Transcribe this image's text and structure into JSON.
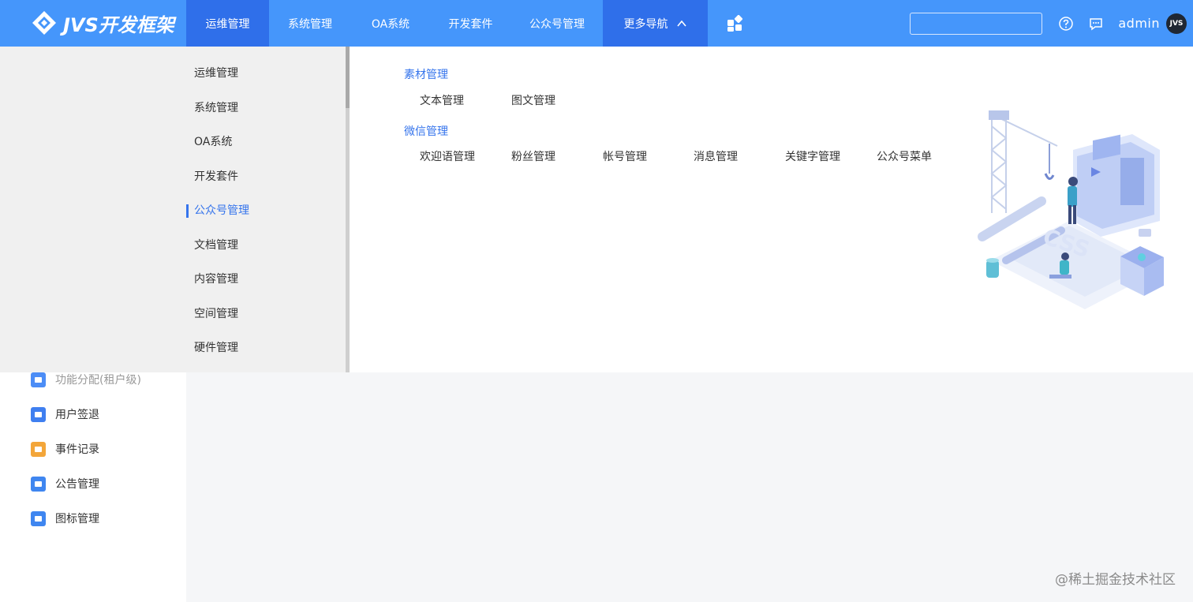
{
  "app": {
    "logo_text": "JVS开发框架"
  },
  "topnav": {
    "items": [
      {
        "label": "运维管理"
      },
      {
        "label": "系统管理"
      },
      {
        "label": "OA系统"
      },
      {
        "label": "开发套件"
      },
      {
        "label": "公众号管理"
      },
      {
        "label": "更多导航"
      }
    ]
  },
  "header": {
    "search_value": "",
    "user": "admin",
    "avatar_text": "JVS"
  },
  "sidebar": {
    "items": [
      {
        "label": "功能分配(租户级)",
        "color": "#4c8df6"
      },
      {
        "label": "用户签退",
        "color": "#3f7ff0"
      },
      {
        "label": "事件记录",
        "color": "#f3a63a"
      },
      {
        "label": "公告管理",
        "color": "#3f86f0"
      },
      {
        "label": "图标管理",
        "color": "#3f86f0"
      }
    ]
  },
  "dropdown": {
    "left_items": [
      {
        "label": "运维管理"
      },
      {
        "label": "系统管理"
      },
      {
        "label": "OA系统"
      },
      {
        "label": "开发套件"
      },
      {
        "label": "公众号管理"
      },
      {
        "label": "文档管理"
      },
      {
        "label": "内容管理"
      },
      {
        "label": "空间管理"
      },
      {
        "label": "硬件管理"
      }
    ],
    "groups": [
      {
        "title": "素材管理",
        "items": [
          "文本管理",
          "图文管理"
        ]
      },
      {
        "title": "微信管理",
        "items": [
          "欢迎语管理",
          "粉丝管理",
          "帐号管理",
          "消息管理",
          "关键字管理",
          "公众号菜单"
        ]
      }
    ]
  },
  "watermark": "@稀土掘金技术社区",
  "colors": {
    "primary": "#4596fb",
    "active_nav": "#2f6fea",
    "link": "#3574ec"
  }
}
